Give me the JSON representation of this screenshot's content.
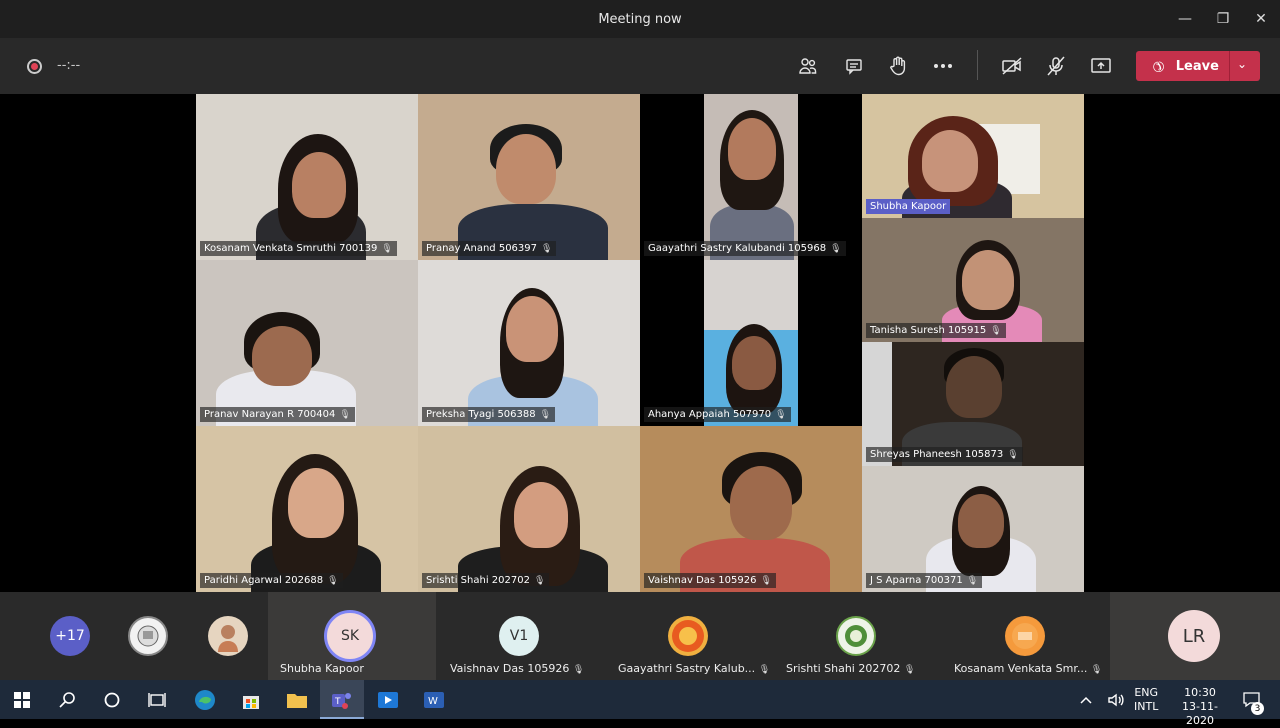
{
  "window": {
    "title": "Meeting now",
    "minimize": "—",
    "restore": "❐",
    "close": "✕"
  },
  "toolbar": {
    "timer": "--:--",
    "leave_label": "Leave",
    "icons": [
      "participants-icon",
      "chat-icon",
      "raise-hand-icon",
      "more-options-icon",
      "camera-off-icon",
      "mic-off-icon",
      "share-screen-icon"
    ]
  },
  "tiles": [
    {
      "name": "Kosanam Venkata Smruthi 700139",
      "bg": "#cfc9c0"
    },
    {
      "name": "Pranay Anand 506397",
      "bg": "#c9b49a"
    },
    {
      "name": "Gaayathri Sastry Kalubandi 105968",
      "bg": "#bfb6b0"
    },
    {
      "name": "Shubha Kapoor",
      "bg": "#d8c8a6",
      "speaking": true
    },
    {
      "name": "Pranav Narayan R 700404",
      "bg": "#c7c2bd"
    },
    {
      "name": "Preksha Tyagi 506388",
      "bg": "#d7d4d1"
    },
    {
      "name": "Ahanya Appaiah 507970",
      "bg": "#d2cbc6"
    },
    {
      "name": "Tanisha Suresh 105915",
      "bg": "#8a7c6e"
    },
    {
      "name": "Shreyas Phaneesh 105873",
      "bg": "#3a3028"
    },
    {
      "name": "Paridhi Agarwal 202688",
      "bg": "#d8c6a8"
    },
    {
      "name": "Srishti Shahi 202702",
      "bg": "#d5c3a5"
    },
    {
      "name": "Vaishnav Das 105926",
      "bg": "#b48a5a"
    },
    {
      "name": "J S Aparna 700371",
      "bg": "#c9c3bb"
    }
  ],
  "strip": {
    "overflow_count": "+17",
    "sk_initials": "SK",
    "sk_name": "Shubha Kapoor",
    "v1_initials": "V1",
    "v1_name": "Vaishnav Das 105926",
    "g_name": "Gaayathri Sastry Kalub...",
    "s_name": "Srishti Shahi 202702",
    "k_name": "Kosanam Venkata Smr...",
    "lr_initials": "LR"
  },
  "taskbar": {
    "lang_top": "ENG",
    "lang_bottom": "INTL",
    "time": "10:30",
    "date": "13-11-2020",
    "notif_count": "3"
  }
}
